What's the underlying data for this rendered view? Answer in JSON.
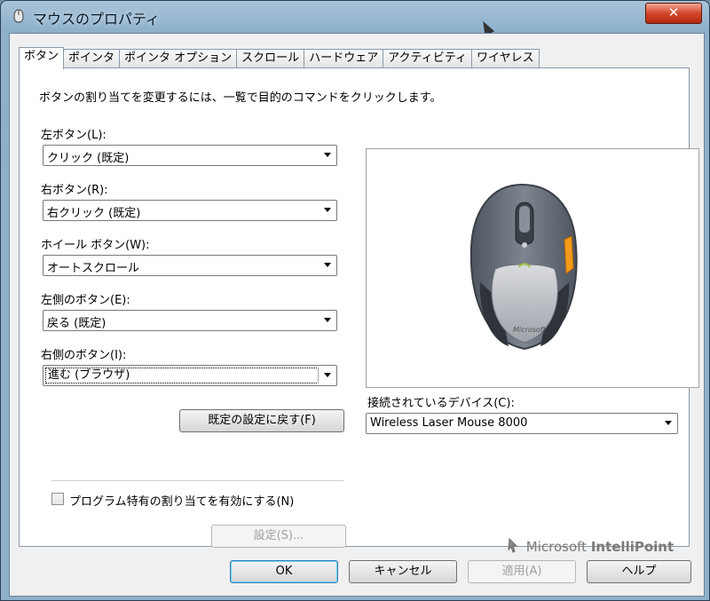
{
  "window": {
    "title": "マウスのプロパティ",
    "close_label": "✕"
  },
  "tabs": [
    {
      "label": "ボタン",
      "active": true
    },
    {
      "label": "ポインタ",
      "active": false
    },
    {
      "label": "ポインタ オプション",
      "active": false
    },
    {
      "label": "スクロール",
      "active": false
    },
    {
      "label": "ハードウェア",
      "active": false
    },
    {
      "label": "アクティビティ",
      "active": false
    },
    {
      "label": "ワイヤレス",
      "active": false
    }
  ],
  "buttons_tab": {
    "description": "ボタンの割り当てを変更するには、一覧で目的のコマンドをクリックします。",
    "left_button": {
      "label": "左ボタン(L):",
      "value": "クリック (既定)"
    },
    "right_button": {
      "label": "右ボタン(R):",
      "value": "右クリック (既定)"
    },
    "wheel_button": {
      "label": "ホイール ボタン(W):",
      "value": "オートスクロール"
    },
    "side_left_button": {
      "label": "左側のボタン(E):",
      "value": "戻る (既定)"
    },
    "side_right_button": {
      "label": "右側のボタン(I):",
      "value": "進む (ブラウザ)"
    },
    "restore_defaults_label": "既定の設定に戻す(F)",
    "connected_device_label": "接続されているデバイス(C):",
    "connected_device_value": "Wireless Laser Mouse 8000",
    "program_specific_label": "プログラム特有の割り当てを有効にする(N)",
    "program_specific_checked": false,
    "settings_label": "設定(S)...",
    "brand_prefix": "Microsoft",
    "brand_name": "IntelliPoint"
  },
  "dialog_buttons": {
    "ok": "OK",
    "cancel": "キャンセル",
    "apply": "適用(A)",
    "help": "ヘルプ"
  },
  "colors": {
    "accent_orange": "#f39a1b",
    "titlebar": "#8db0cb",
    "close_red": "#d2472c"
  }
}
